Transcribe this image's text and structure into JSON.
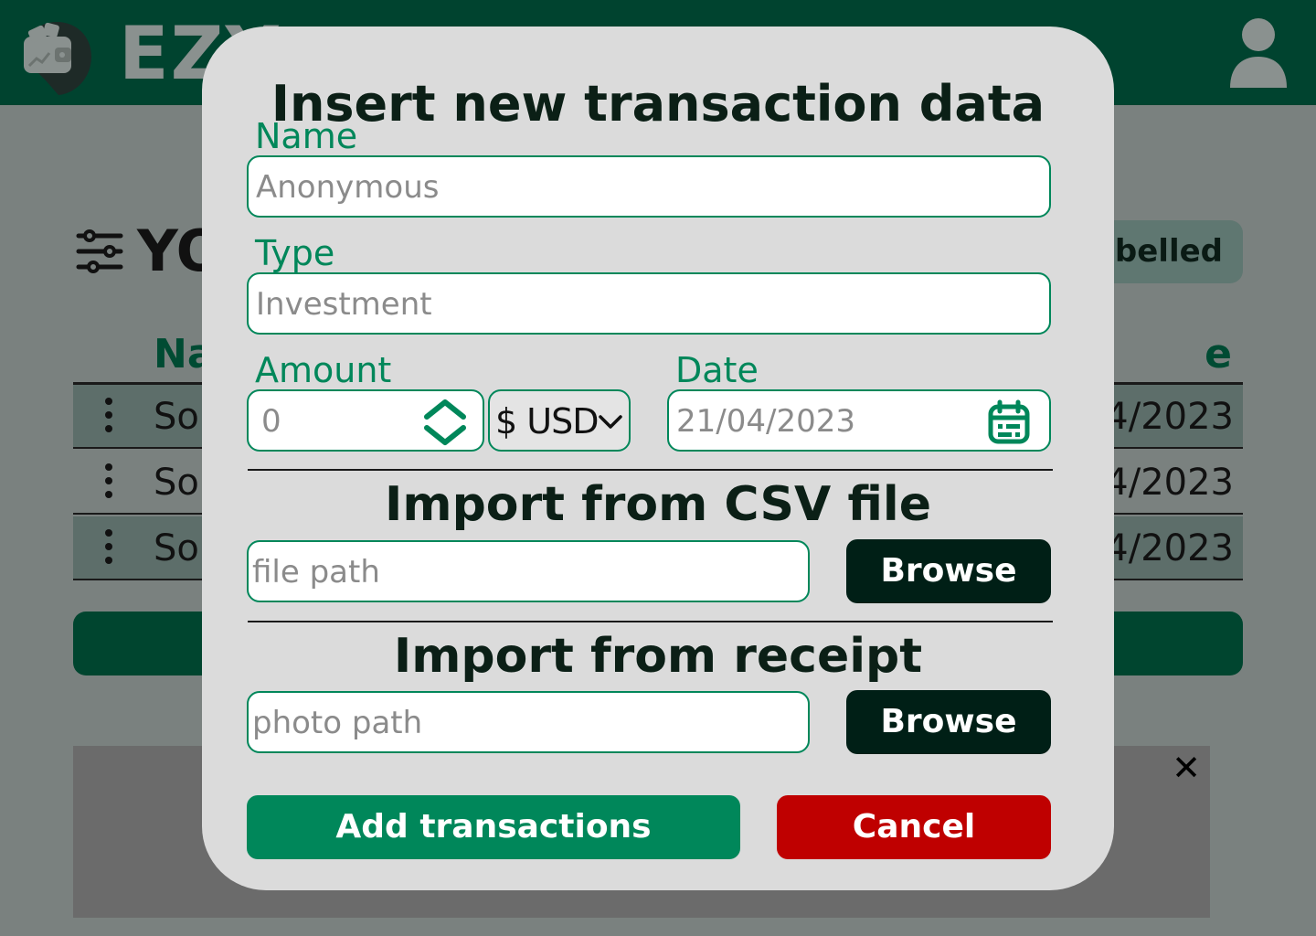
{
  "app": {
    "logo_text": "EZY",
    "page_title": "YO",
    "labelled_chip": "abelled",
    "table": {
      "name_header": "Na",
      "date_header": "e",
      "rows": [
        {
          "name": "Sor",
          "date": "4/2023"
        },
        {
          "name": "Sor",
          "date": "4/2023"
        },
        {
          "name": "Sor",
          "date": "4/2023"
        }
      ]
    },
    "close_glyph": "✕"
  },
  "modal": {
    "title": "Insert new transaction data",
    "name": {
      "label": "Name",
      "placeholder": "Anonymous"
    },
    "type": {
      "label": "Type",
      "placeholder": "Investment"
    },
    "amount": {
      "label": "Amount",
      "placeholder": "0"
    },
    "currency": {
      "selected": "$ USD"
    },
    "date": {
      "label": "Date",
      "placeholder": "21/04/2023"
    },
    "csv": {
      "title": "Import from CSV file",
      "placeholder": "file path",
      "browse_label": "Browse"
    },
    "receipt": {
      "title": "Import from receipt",
      "placeholder": "photo path",
      "browse_label": "Browse"
    },
    "add_label": "Add transactions",
    "cancel_label": "Cancel"
  },
  "colors": {
    "topbar": "#00432f",
    "accent_green": "#00875a",
    "cancel_red": "#bf0000",
    "dark_button": "#001f16",
    "modal_bg": "#dbdbdb"
  },
  "icons": [
    "wallet-icon",
    "user-icon",
    "filter-icon",
    "kebab-icon",
    "stepper-icon",
    "chevron-down-icon",
    "calendar-icon",
    "close-icon"
  ]
}
